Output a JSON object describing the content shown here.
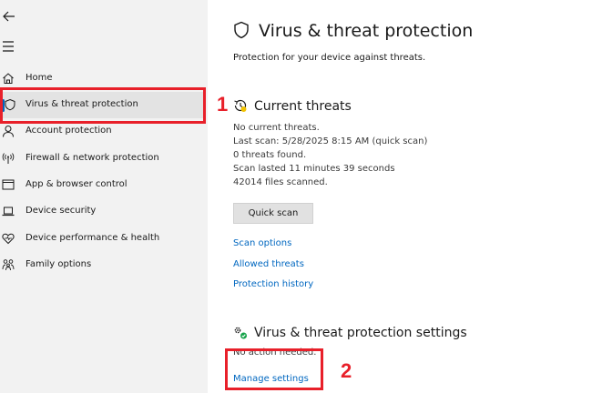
{
  "sidebar": {
    "items": [
      {
        "label": "Home",
        "icon": "home-icon"
      },
      {
        "label": "Virus & threat protection",
        "icon": "shield-icon"
      },
      {
        "label": "Account protection",
        "icon": "person-icon"
      },
      {
        "label": "Firewall & network protection",
        "icon": "wifi-antenna-icon"
      },
      {
        "label": "App & browser control",
        "icon": "app-window-icon"
      },
      {
        "label": "Device security",
        "icon": "laptop-icon"
      },
      {
        "label": "Device performance & health",
        "icon": "heart-icon"
      },
      {
        "label": "Family options",
        "icon": "family-icon"
      }
    ],
    "active_index": 1
  },
  "annotations": {
    "marker_1": "1",
    "marker_2": "2",
    "color": "#e8202a"
  },
  "main": {
    "title": "Virus & threat protection",
    "subtitle": "Protection for your device against threats.",
    "current_threats": {
      "heading": "Current threats",
      "status": "No current threats.",
      "last_scan": "Last scan: 5/28/2025 8:15 AM (quick scan)",
      "threats_found": "0 threats found.",
      "duration": "Scan lasted 11 minutes 39 seconds",
      "files_scanned": "42014 files scanned.",
      "quick_scan_label": "Quick scan",
      "links": [
        "Scan options",
        "Allowed threats",
        "Protection history"
      ]
    },
    "settings": {
      "heading": "Virus & threat protection settings",
      "status": "No action needed.",
      "manage_link": "Manage settings"
    }
  },
  "colors": {
    "accent": "#0067c0",
    "sidebar_bg": "#f2f2f2",
    "selected_bg": "#e3e3e3"
  }
}
